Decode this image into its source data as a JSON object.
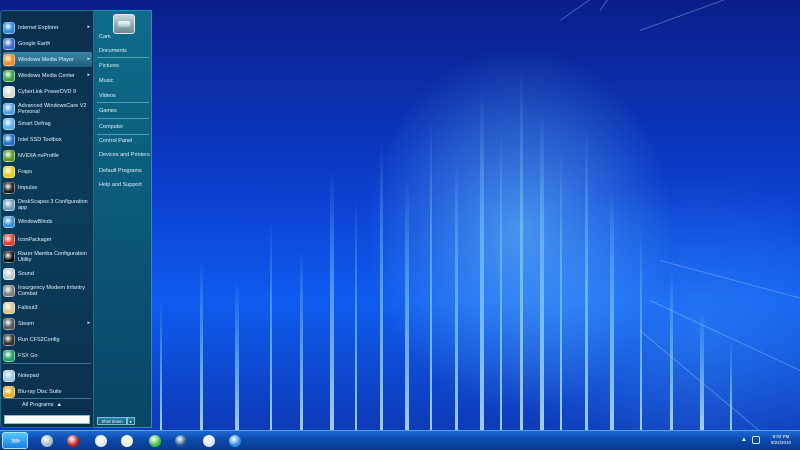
{
  "start_menu": {
    "programs": [
      {
        "label": "Internet Explorer",
        "icon": "internet-explorer-icon",
        "color": "#2a8ae0",
        "highlight": false,
        "submenu": true
      },
      {
        "label": "Google Earth",
        "icon": "google-earth-icon",
        "color": "#3a6ad0",
        "highlight": false,
        "submenu": false
      },
      {
        "label": "Windows Media Player",
        "icon": "windows-media-player-icon",
        "color": "#f08a20",
        "highlight": true,
        "submenu": true
      },
      {
        "label": "Windows Media Center",
        "icon": "windows-media-center-icon",
        "color": "#3aa040",
        "highlight": false,
        "submenu": true
      },
      {
        "label": "CyberLink PowerDVD 9",
        "icon": "powerdvd-icon",
        "color": "#d8d8d8",
        "highlight": false,
        "submenu": false
      },
      {
        "label": "Advanced WindowsCare V2 Personal",
        "icon": "windowscare-icon",
        "color": "#4aa0e8",
        "highlight": false,
        "submenu": false
      },
      {
        "label": "Smart Defrag",
        "icon": "smart-defrag-icon",
        "color": "#5ab0f0",
        "highlight": false,
        "submenu": false
      },
      {
        "label": "Intel SSD Toolbox",
        "icon": "intel-icon",
        "color": "#1a70c8",
        "highlight": false,
        "submenu": false
      },
      {
        "label": "NVIDIA nvProfile",
        "icon": "nvidia-icon",
        "color": "#5a9a20",
        "highlight": false,
        "submenu": false
      },
      {
        "label": "Fraps",
        "icon": "fraps-icon",
        "color": "#e8d020",
        "highlight": false,
        "submenu": false
      },
      {
        "label": "Impulse",
        "icon": "impulse-icon",
        "color": "#202020",
        "highlight": false,
        "submenu": false
      },
      {
        "label": "DeskScapes 3 Configuration app",
        "icon": "deskscapes-icon",
        "color": "#70a0c0",
        "highlight": false,
        "submenu": false
      },
      {
        "label": "WindowBlinds",
        "icon": "windowblinds-icon",
        "color": "#3a90d8",
        "highlight": false,
        "submenu": false
      },
      {
        "label": "IconPackager",
        "icon": "iconpackager-icon",
        "color": "#e04030",
        "highlight": false,
        "submenu": false
      },
      {
        "label": "Razer Mamba Configuration Utility",
        "icon": "razer-icon",
        "color": "#101010",
        "highlight": false,
        "submenu": false
      },
      {
        "label": "Sound",
        "icon": "sound-icon",
        "color": "#c0c8d0",
        "highlight": false,
        "submenu": false
      },
      {
        "label": "Insurgency Modern Infantry Combat",
        "icon": "insurgency-icon",
        "color": "#808080",
        "highlight": false,
        "submenu": false
      },
      {
        "label": "Fallout3",
        "icon": "fallout-icon",
        "color": "#d8c890",
        "highlight": false,
        "submenu": false
      },
      {
        "label": "Steam",
        "icon": "steam-icon",
        "color": "#505860",
        "highlight": false,
        "submenu": true
      },
      {
        "label": "Run CFS2Config",
        "icon": "cfs2-icon",
        "color": "#303030",
        "highlight": false,
        "submenu": false
      },
      {
        "label": "FSX Go",
        "icon": "fsx-icon",
        "color": "#20a060",
        "highlight": false,
        "submenu": false
      },
      {
        "label": "Notepad",
        "icon": "notepad-icon",
        "color": "#a0c8e8",
        "highlight": false,
        "submenu": false
      },
      {
        "label": "Blu-ray Disc Suite",
        "icon": "bluray-icon",
        "color": "#e8b020",
        "highlight": false,
        "submenu": false
      }
    ],
    "all_programs": "All Programs",
    "search_placeholder": "",
    "places": [
      {
        "label": "Cam"
      },
      {
        "label": "Documents"
      },
      {
        "label": "Pictures"
      },
      {
        "label": "Music"
      },
      {
        "label": "Videos"
      },
      {
        "label": "Games"
      },
      {
        "label": "Computer"
      },
      {
        "label": "Control Panel"
      },
      {
        "label": "Devices and Printers"
      },
      {
        "label": "Default Programs"
      },
      {
        "label": "Help and Support"
      }
    ],
    "shutdown_label": "Shut down",
    "shutdown_arrow": "▸"
  },
  "taskbar": {
    "start_glyph": "»»",
    "pinned": [
      {
        "icon": "media-center-icon",
        "color": "#a0b8c8"
      },
      {
        "icon": "game-shield-icon",
        "color": "#c02020"
      },
      {
        "icon": "flight-sim-icon",
        "color": "#e0e8f0"
      },
      {
        "icon": "clock-gadget-icon",
        "color": "#f0f0e0"
      },
      {
        "icon": "monitor-icon",
        "color": "#40c040"
      },
      {
        "icon": "fsx-tile-icon",
        "color": "#1f4f90"
      },
      {
        "icon": "airplane-icon",
        "color": "#d8e8f8"
      },
      {
        "icon": "internet-explorer-taskbar-icon",
        "color": "#2a8ae0"
      }
    ],
    "tray_expand": "▲",
    "clock_time": "9:03 PM",
    "clock_date": "9/22/2010"
  }
}
